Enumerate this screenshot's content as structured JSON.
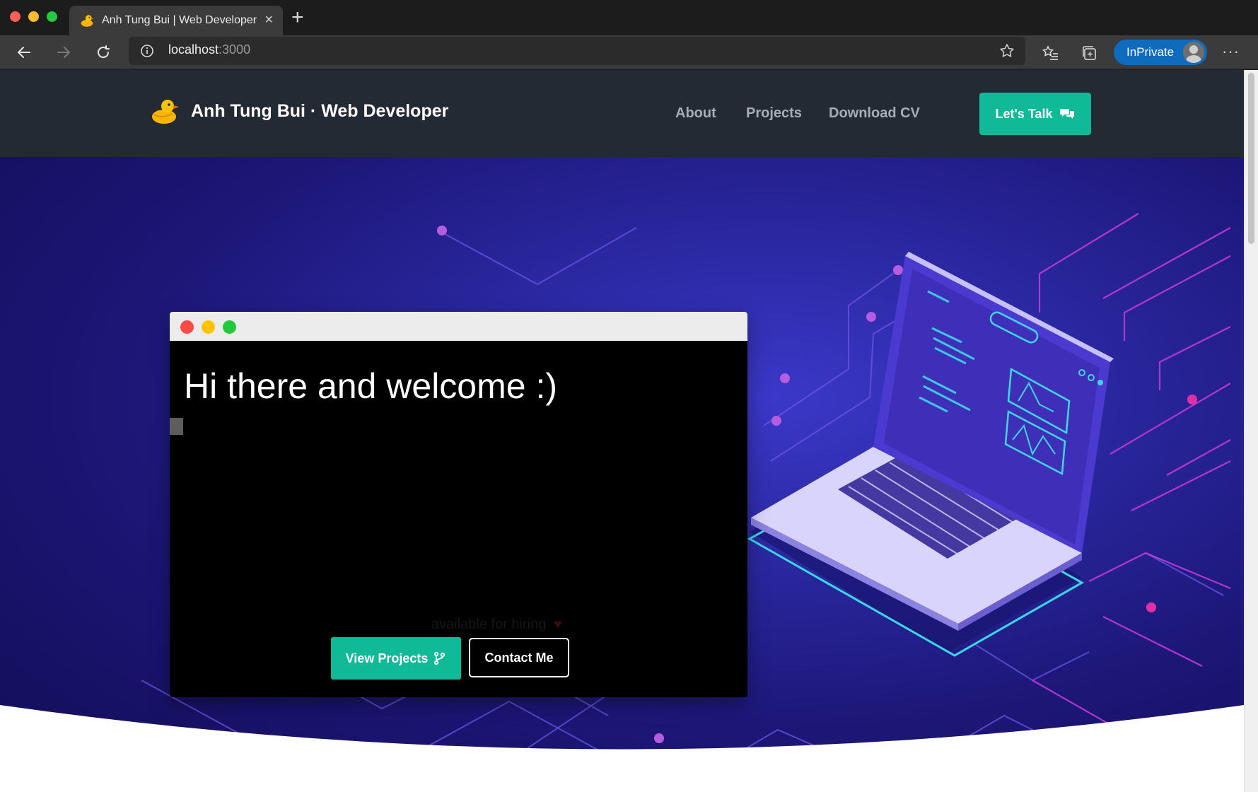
{
  "browser": {
    "tab_title": "Anh Tung Bui | Web Developer",
    "tab_close": "×",
    "new_tab": "+",
    "url_host": "localhost",
    "url_port": ":3000",
    "inprivate_label": "InPrivate",
    "more_label": "···"
  },
  "site": {
    "brand": "Anh Tung Bui · Web Developer",
    "nav": {
      "about": "About",
      "projects": "Projects",
      "download_cv": "Download CV"
    },
    "talk_button": "Let's Talk"
  },
  "terminal": {
    "heading": "Hi there and welcome :)",
    "hiring_text": "available for hiring",
    "heart": "♥",
    "view_projects": "View Projects",
    "contact_me": "Contact Me"
  },
  "colors": {
    "accent": "#10b998",
    "nav_bg": "#232a33",
    "hero_bg": "#1c1676",
    "inprivate": "#0f6cbd"
  },
  "icons": {
    "favicon": "duck-icon",
    "talk": "chat-bubbles-icon",
    "view_projects": "code-branch-icon"
  }
}
